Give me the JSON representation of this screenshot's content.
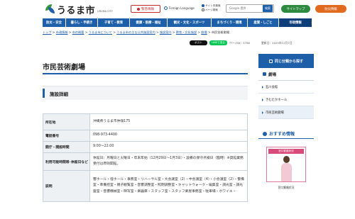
{
  "header": {
    "logo_text": "うるま市",
    "logo_sub": "URUMA CITY",
    "emergency_label": "緊急情報",
    "language_label": "Foreign Language",
    "search_scope": [
      "サイト内検索",
      "ページ検索"
    ],
    "search_placeholder": "Google 提供",
    "search_button": "検索",
    "sitemap_label": "サイトマップ",
    "disaster_label": "防災情報"
  },
  "nav": {
    "items": [
      "防災・安全",
      "暮らし・手続き",
      "子育て・教育",
      "健康・医療・福祉",
      "観光・文化・スポーツ",
      "まちづくり・環境",
      "産業・しごと",
      "市政情報"
    ],
    "active_index": 7
  },
  "breadcrumb": {
    "items": [
      "トップ",
      "市政情報",
      "市の概要",
      "うるま市について",
      "うるま市の主な公共施設案内",
      "施設案内",
      "教育・文化施設",
      "劇場"
    ],
    "current": "市民芸術劇場",
    "separator": " > "
  },
  "share": {
    "x_label": "ポスト",
    "line_label": "LINEで送る",
    "page_id": "ページID：3796",
    "updated": "更新日：2025年12月7日"
  },
  "page": {
    "title": "市民芸術劇場",
    "section": "施設詳細"
  },
  "details": {
    "rows": [
      {
        "label": "所在地",
        "value": "沖縄県うるま市仲嶺175"
      },
      {
        "label": "電話番号",
        "value": "098-973-4400"
      },
      {
        "label": "開庁・開館時間",
        "value": "9:00～22:00"
      },
      {
        "label": "利用可能時間帯･休館日など",
        "value": "休館日：月曜日と火曜日・年末年始（12月29日～1月3日）・設備の保守点検日（臨時）※貸館業務受付は原則開館。"
      },
      {
        "label": "説明",
        "value": "響ホール・燈ホール・事務室・リハーサル室・大会議室（2）・中会議室（4）・小会議室（2）・警備室・準備控室・親子観覧室・音響調整室・照明調整室・キャットウォーク・編集室・調光室・調光盤室・音響機械室・映写室・楽器庫・スタッフ室・スタッフ楽屋事務室・駐車場・ホワイエ・"
      }
    ]
  },
  "sidebar": {
    "heading": "同じ分類から探す",
    "category": "劇場",
    "items": [
      "石川会館",
      "きむたかホール",
      "市民芸術劇場"
    ],
    "current_index": 2,
    "recommend_title": "おすすめ情報",
    "recommend_banner_label": "窓口繁雑状況",
    "recommend_caption": "窓口繁雑状況"
  },
  "colors": {
    "brand_blue": "#1d5fa8",
    "emergency_red": "#c92a2a",
    "sitemap_green": "#2d8a3e",
    "disaster_orange": "#e06b1f"
  }
}
